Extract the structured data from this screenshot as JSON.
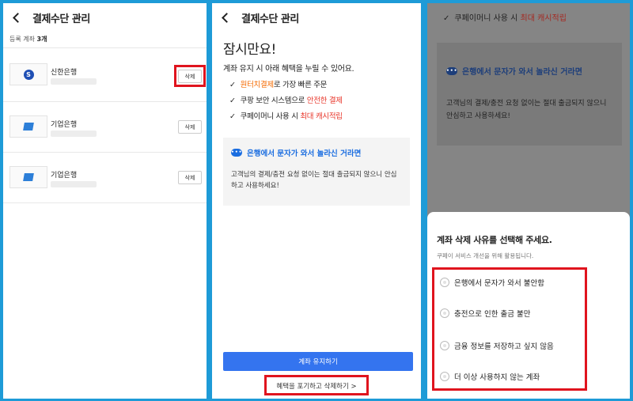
{
  "header": {
    "title": "결제수단 관리"
  },
  "accounts": {
    "count_label": "등록 계좌",
    "count_value": "3개",
    "items": [
      {
        "bank": "신한은행",
        "logo_icon": "shinhan-logo-icon",
        "logo_text": "S",
        "delete_label": "삭제"
      },
      {
        "bank": "기업은행",
        "logo_icon": "ibk-logo-icon",
        "delete_label": "삭제"
      },
      {
        "bank": "기업은행",
        "logo_icon": "ibk-logo-icon",
        "delete_label": "삭제"
      }
    ]
  },
  "retention": {
    "heading": "잠시만요!",
    "subtitle": "계좌 유지 시 아래 혜택을 누릴 수 있어요.",
    "benefits": [
      {
        "highlight": "원터치결제",
        "rest": "로 가장 빠른 주문",
        "highlight_color": "#f56a00"
      },
      {
        "prefix": "쿠팡 보안 시스템으로 ",
        "highlight": "안전한 결제",
        "highlight_color": "#e8362a"
      },
      {
        "prefix": "쿠페이머니 사용 시 ",
        "highlight": "최대 캐시적립",
        "highlight_color": "#e8362a"
      }
    ],
    "notice_title": "은행에서 문자가 와서 놀라신 거라면",
    "notice_body": "고객님의 결제/충전 요청 없이는 절대 출금되지 않으니 안심하고 사용하세요!",
    "keep_button": "계좌 유지하기",
    "remove_link": "혜택을 포기하고 삭제하기 >"
  },
  "reason_sheet": {
    "title": "계좌 삭제 사유를 선택해 주세요.",
    "subtitle": "쿠페이 서비스 개선을 위해 활용됩니다.",
    "reasons": [
      "은행에서 문자가 와서 불안함",
      "충전으로 인한 출금 불만",
      "금융 정보를 저장하고 싶지 않음",
      "더 이상 사용하지 않는 계좌"
    ]
  },
  "colors": {
    "frame": "#1e9bd7",
    "primary": "#3474ef",
    "highlight_red": "#e0141e",
    "accent_orange": "#f56a00"
  }
}
